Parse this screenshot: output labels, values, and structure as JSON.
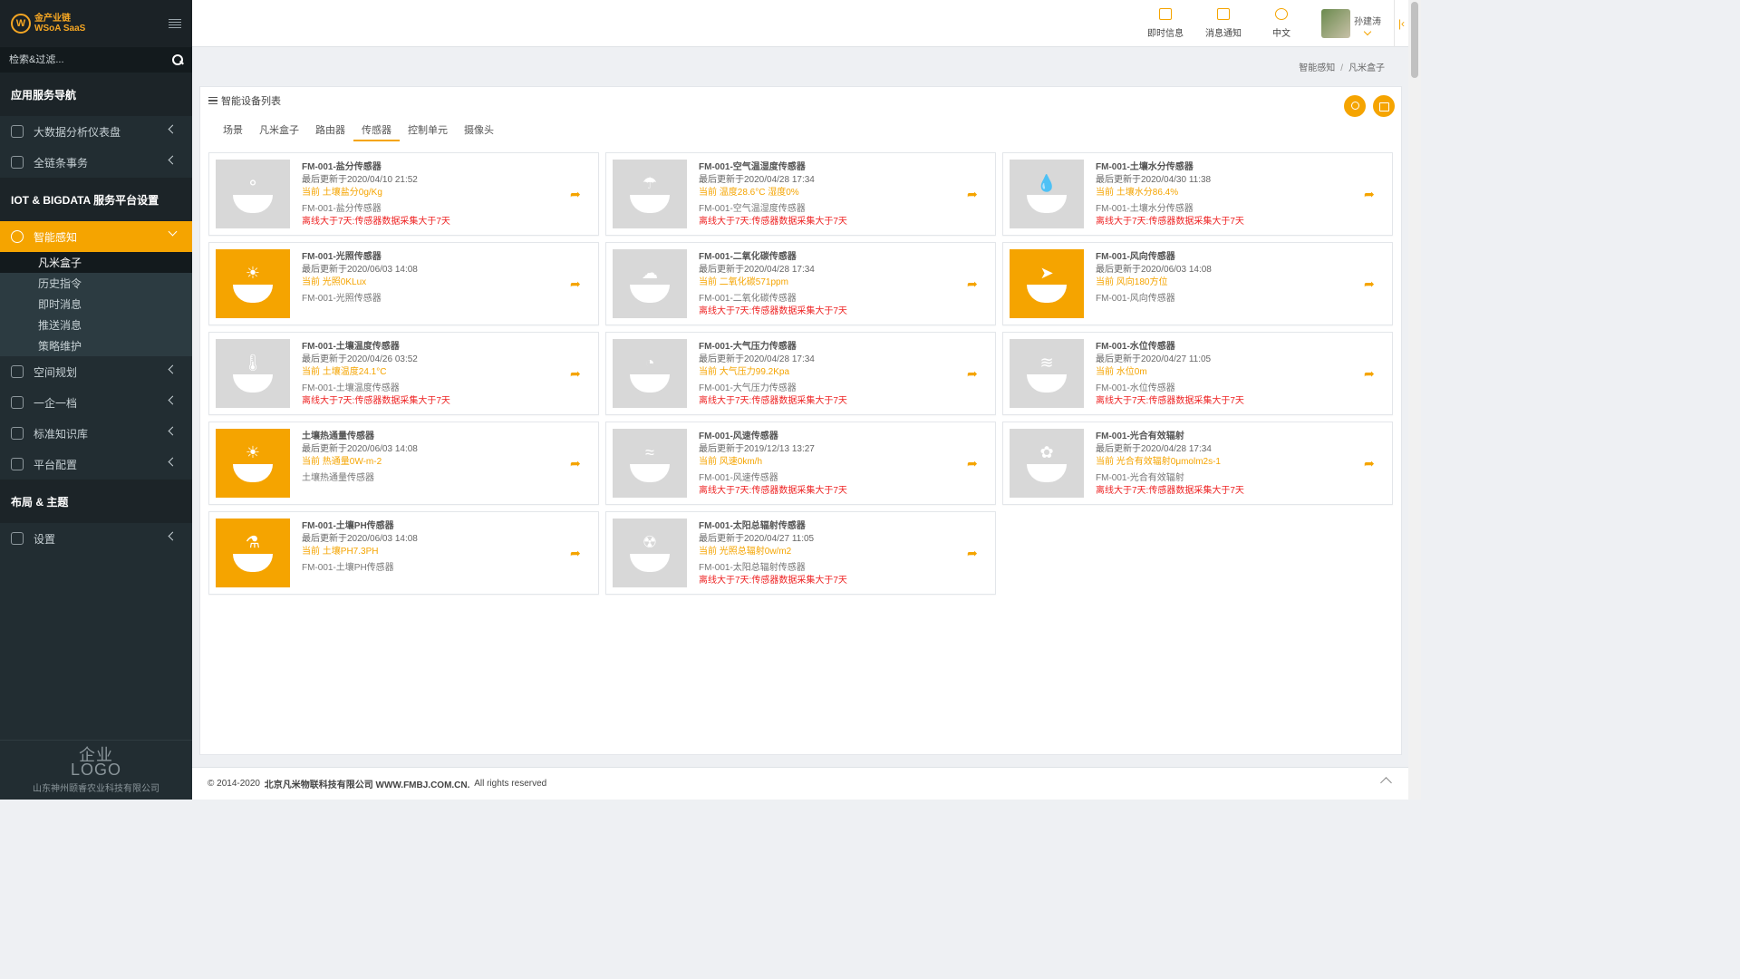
{
  "brand": {
    "logo_text_line1": "金产业链",
    "logo_text_line2": "WSoA SaaS"
  },
  "search": {
    "placeholder": "检索&过滤..."
  },
  "sidebar": {
    "section1": "应用服务导航",
    "section2": "IOT & BIGDATA 服务平台设置",
    "section3": "布局 & 主题",
    "items_top": [
      {
        "label": "大数据分析仪表盘"
      },
      {
        "label": "全链条事务"
      }
    ],
    "active": {
      "label": "智能感知"
    },
    "sub_items": [
      {
        "label": "凡米盒子"
      },
      {
        "label": "历史指令"
      },
      {
        "label": "即时消息"
      },
      {
        "label": "推送消息"
      },
      {
        "label": "策略维护"
      }
    ],
    "items_bottom": [
      {
        "label": "空间规划"
      },
      {
        "label": "一企一档"
      },
      {
        "label": "标准知识库"
      },
      {
        "label": "平台配置"
      }
    ],
    "settings": {
      "label": "设置"
    },
    "footer_logo_top": "企业",
    "footer_logo_bottom": "LOGO",
    "footer_company": "山东神州颐睿农业科技有限公司"
  },
  "topbar": {
    "instant": "即时信息",
    "notify": "消息通知",
    "lang": "中文",
    "user": "孙建涛"
  },
  "breadcrumb": {
    "parent": "智能感知",
    "current": "凡米盒子"
  },
  "panel": {
    "title": "智能设备列表",
    "tabs": [
      "场景",
      "凡米盒子",
      "路由器",
      "传感器",
      "控制单元",
      "摄像头"
    ],
    "active_tab_index": 3
  },
  "cards": [
    {
      "name": "FM-001-盐分传感器",
      "updated": "最后更新于2020/04/10 21:52",
      "current": "当前 土壤盐分0g/Kg",
      "desc": "FM-001-盐分传感器",
      "warn": "离线大于7天:传感器数据采集大于7天",
      "highlight": false,
      "icon": "salt-icon"
    },
    {
      "name": "FM-001-空气温湿度传感器",
      "updated": "最后更新于2020/04/28 17:34",
      "current": "当前 温度28.6°C 湿度0%",
      "desc": "FM-001-空气温湿度传感器",
      "warn": "离线大于7天:传感器数据采集大于7天",
      "highlight": false,
      "icon": "thermometer-umbrella-icon"
    },
    {
      "name": "FM-001-土壤水分传感器",
      "updated": "最后更新于2020/04/30 11:38",
      "current": "当前 土壤水分86.4%",
      "desc": "FM-001-土壤水分传感器",
      "warn": "离线大于7天:传感器数据采集大于7天",
      "highlight": false,
      "icon": "water-drop-icon"
    },
    {
      "name": "FM-001-光照传感器",
      "updated": "最后更新于2020/06/03 14:08",
      "current": "当前 光照0KLux",
      "desc": "FM-001-光照传感器",
      "warn": "",
      "highlight": true,
      "icon": "sun-icon"
    },
    {
      "name": "FM-001-二氧化碳传感器",
      "updated": "最后更新于2020/04/28 17:34",
      "current": "当前 二氧化碳571ppm",
      "desc": "FM-001-二氧化碳传感器",
      "warn": "离线大于7天:传感器数据采集大于7天",
      "highlight": false,
      "icon": "co2-icon"
    },
    {
      "name": "FM-001-风向传感器",
      "updated": "最后更新于2020/06/03 14:08",
      "current": "当前 风向180方位",
      "desc": "FM-001-风向传感器",
      "warn": "",
      "highlight": true,
      "icon": "wind-vane-icon"
    },
    {
      "name": "FM-001-土壤温度传感器",
      "updated": "最后更新于2020/04/26 03:52",
      "current": "当前 土壤温度24.1°C",
      "desc": "FM-001-土壤温度传感器",
      "warn": "离线大于7天:传感器数据采集大于7天",
      "highlight": false,
      "icon": "soil-thermometer-icon"
    },
    {
      "name": "FM-001-大气压力传感器",
      "updated": "最后更新于2020/04/28 17:34",
      "current": "当前 大气压力99.2Kpa",
      "desc": "FM-001-大气压力传感器",
      "warn": "离线大于7天:传感器数据采集大于7天",
      "highlight": false,
      "icon": "pressure-gauge-icon"
    },
    {
      "name": "FM-001-水位传感器",
      "updated": "最后更新于2020/04/27 11:05",
      "current": "当前 水位0m",
      "desc": "FM-001-水位传感器",
      "warn": "离线大于7天:传感器数据采集大于7天",
      "highlight": false,
      "icon": "water-level-icon"
    },
    {
      "name": "土壤热通量传感器",
      "updated": "最后更新于2020/06/03 14:08",
      "current": "当前 热通量0W-m-2",
      "desc": "土壤热通量传感器",
      "warn": "",
      "highlight": true,
      "icon": "heat-flux-icon"
    },
    {
      "name": "FM-001-风速传感器",
      "updated": "最后更新于2019/12/13 13:27",
      "current": "当前 风速0km/h",
      "desc": "FM-001-风速传感器",
      "warn": "离线大于7天:传感器数据采集大于7天",
      "highlight": false,
      "icon": "wind-speed-icon"
    },
    {
      "name": "FM-001-光合有效辐射",
      "updated": "最后更新于2020/04/28 17:34",
      "current": "当前 光合有效辐射0μmolm2s-1",
      "desc": "FM-001-光合有效辐射",
      "warn": "离线大于7天:传感器数据采集大于7天",
      "highlight": false,
      "icon": "par-icon"
    },
    {
      "name": "FM-001-土壤PH传感器",
      "updated": "最后更新于2020/06/03 14:08",
      "current": "当前 土壤PH7.3PH",
      "desc": "FM-001-土壤PH传感器",
      "warn": "",
      "highlight": true,
      "icon": "ph-icon"
    },
    {
      "name": "FM-001-太阳总辐射传感器",
      "updated": "最后更新于2020/04/27 11:05",
      "current": "当前 光照总辐射0w/m2",
      "desc": "FM-001-太阳总辐射传感器",
      "warn": "离线大于7天:传感器数据采集大于7天",
      "highlight": false,
      "icon": "radiation-icon"
    }
  ],
  "footer": {
    "copyright": "© 2014-2020",
    "company": "北京凡米物联科技有限公司 WWW.FMBJ.COM.CN.",
    "rights": "All rights reserved"
  },
  "colors": {
    "accent": "#f5a400",
    "sidebar_bg": "#222d32",
    "warn": "#e22222"
  }
}
